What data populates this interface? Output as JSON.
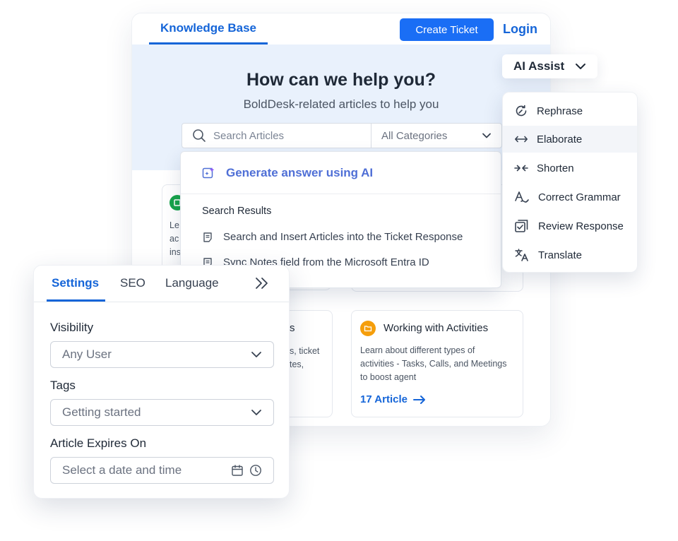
{
  "kb": {
    "tab_label": "Knowledge Base",
    "create_ticket_label": "Create Ticket",
    "login_label": "Login",
    "hero_title": "How can we help you?",
    "hero_subtitle": "BoldDesk-related articles to help you",
    "search_placeholder": "Search Articles",
    "category_value": "All Categories"
  },
  "dropdown": {
    "generate_label": "Generate answer using AI",
    "results_title": "Search Results",
    "results": [
      "Search and Insert Articles into the Ticket Response",
      "Sync Notes field from the Microsoft Entra ID"
    ]
  },
  "cards": {
    "left_partial": [
      "Le",
      "ac",
      "ins"
    ],
    "middle_title_partial": "s",
    "middle_desc_partial": [
      "s, ticket",
      "tes,"
    ],
    "activities": {
      "title": "Working with Activities",
      "desc": [
        "Learn about different types of",
        "activities - Tasks, Calls, and Meetings",
        "to boost agent"
      ],
      "link": "17 Article"
    }
  },
  "ai_assist": {
    "label": "AI Assist",
    "items": [
      "Rephrase",
      "Elaborate",
      "Shorten",
      "Correct Grammar",
      "Review Response",
      "Translate"
    ]
  },
  "settings": {
    "tabs": [
      "Settings",
      "SEO",
      "Language"
    ],
    "visibility_label": "Visibility",
    "visibility_value": "Any User",
    "tags_label": "Tags",
    "tags_value": "Getting started",
    "expires_label": "Article Expires On",
    "expires_placeholder": "Select a date and time"
  },
  "colors": {
    "accent": "#1565d8",
    "button": "#1a6ef5",
    "hero_bg": "#e9f1fc",
    "ai_text": "#4f6fd6",
    "card_icon_green": "#16a34a",
    "card_icon_orange": "#f59e0b"
  }
}
